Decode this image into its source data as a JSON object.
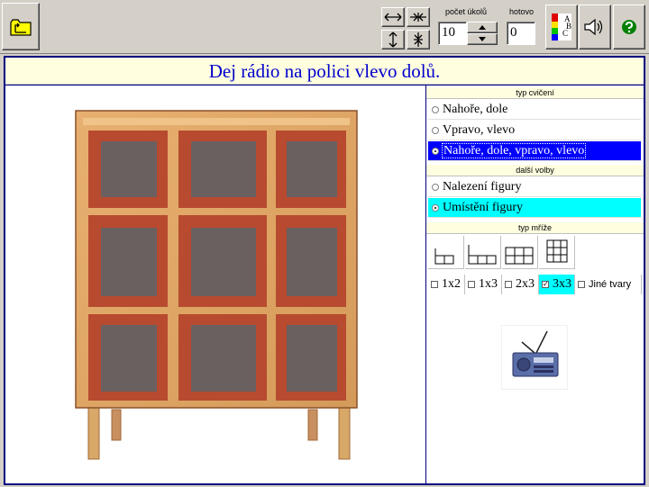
{
  "toolbar": {
    "folder_icon": "folder-up-icon",
    "counter_label": "počet úkolů",
    "counter_value": "10",
    "done_label": "hotovo",
    "done_value": "0",
    "abc_icon": "abc-palette-icon",
    "sound_icon": "speaker-icon",
    "help_icon": "help-icon"
  },
  "task": {
    "text": "Dej rádio na polici vlevo dolů."
  },
  "exercise_type": {
    "header": "typ cvičení",
    "options": [
      {
        "label": "Nahoře, dole",
        "selected": false
      },
      {
        "label": "Vpravo, vlevo",
        "selected": false
      },
      {
        "label": "Nahoře, dole, vpravo, vlevo",
        "selected": true
      }
    ]
  },
  "more_options": {
    "header": "další volby",
    "options": [
      {
        "label": "Nalezení figury",
        "selected": false
      },
      {
        "label": "Umístění figury",
        "selected": true
      }
    ]
  },
  "grid_type": {
    "header": "typ mříže",
    "checks": [
      {
        "label": "1x2",
        "checked": false
      },
      {
        "label": "1x3",
        "checked": false
      },
      {
        "label": "2x3",
        "checked": false
      },
      {
        "label": "3x3",
        "checked": true
      },
      {
        "label": "Jiné tvary",
        "checked": false
      }
    ]
  },
  "figure": {
    "icon": "radio-icon"
  },
  "colors": {
    "accent_blue": "#0000ff",
    "accent_cyan": "#00ffff",
    "title_text": "#0000cc"
  }
}
